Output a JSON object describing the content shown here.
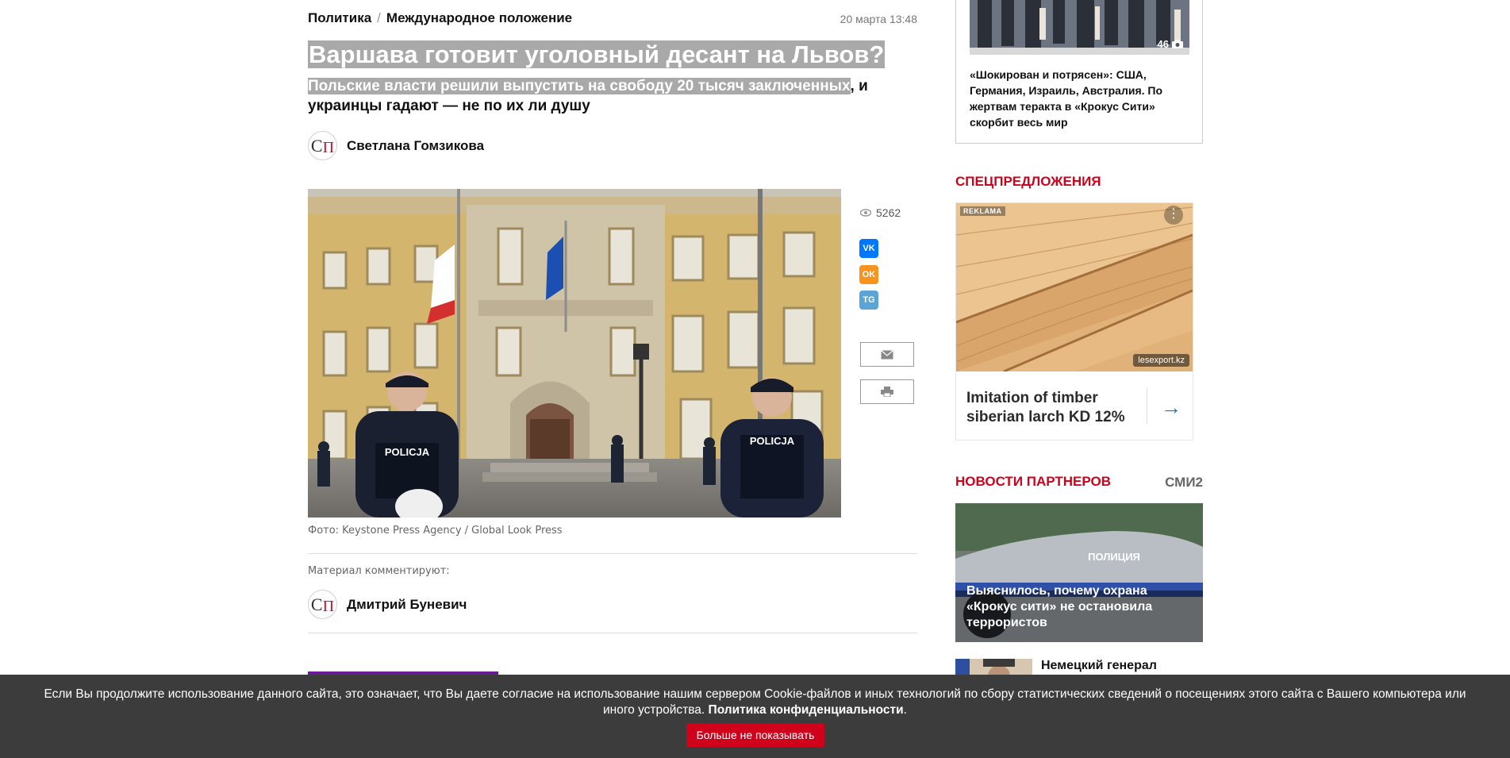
{
  "breadcrumb": {
    "section": "Политика",
    "separator": "/",
    "subsection": "Международное положение"
  },
  "date": "20 марта 13:48",
  "headline": "Варшава готовит уголовный десант на Львов?",
  "lead": {
    "highlighted": "Польские власти решили выпустить на свободу 20 тысяч заключенных",
    "rest": ", и украинцы гадают — не по их ли душу"
  },
  "author": {
    "logo_c": "С",
    "logo_p": "П",
    "name": "Светлана Гомзикова"
  },
  "photo": {
    "caption": "Фото: Keystone Press Agency / Global Look Press",
    "sign_left": "POLICJA",
    "sign_right": "POLICJA"
  },
  "share": {
    "views": "5262",
    "vk": "VK",
    "ok": "OK",
    "tg": "TG"
  },
  "commentators": {
    "label": "Материал комментируют:",
    "name": "Дмитрий Буневич",
    "logo_c": "С",
    "logo_p": "П"
  },
  "sidebar": {
    "gallery": {
      "count": "46",
      "text": "«Шокирован и потрясен»: США, Германия, Израиль, Австралия. По жертвам теракта в «Крокус Сити» скорбит весь мир"
    },
    "special_offers_title": "Спецпредложения",
    "promo": {
      "reklama": "REKLAMA",
      "menu": "⋮",
      "domain": "lesexport.kz",
      "text": "Imitation of timber siberian larch KD 12%",
      "arrow": "→"
    },
    "partner_news_title": "Новости партнеров",
    "smi2": "СМИ2",
    "partner_card": {
      "sign": "ПОЛИЦИЯ",
      "text": "Выяснилось, почему охрана «Крокус сити» не остановила террористов"
    },
    "partner_item2": {
      "text": "Немецкий генерал"
    }
  },
  "cookie": {
    "text": "Если Вы продолжите использование данного сайта, это означает, что Вы даете согласие на использование нашим сервером Cookie-файлов и иных технологий по сбору статистических сведений о посещениях этого сайта с Вашего компьютера или иного устройства. ",
    "policy_link": "Политика конфиденциальности",
    "period": ".",
    "button": "Больше не показывать"
  },
  "colors": {
    "accent_red": "#d0021b",
    "highlight_gray": "#a9a9a9",
    "banner_bg": "#3c3c3c"
  }
}
